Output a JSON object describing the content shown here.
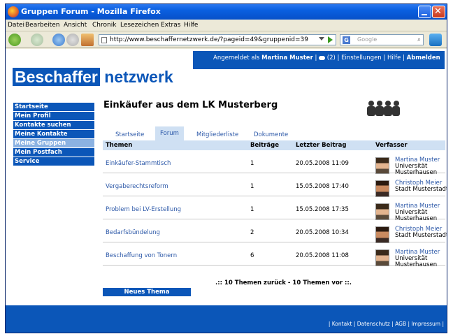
{
  "window": {
    "title": "Gruppen Forum - Mozilla Firefox"
  },
  "menu": [
    "Datei",
    "Bearbeiten",
    "Ansicht",
    "Chronik",
    "Lesezeichen",
    "Extras",
    "Hilfe"
  ],
  "toolbar": {
    "url": "http://www.beschaffernetzwerk.de/?pageid=49&gruppenid=39",
    "search_placeholder": "Google"
  },
  "userbar": {
    "prefix": "Angemeldet als",
    "user": "Martina Muster",
    "sep1": " | ",
    "messages": "(2)",
    "sep2": " | ",
    "settings": "Einstellungen",
    "sep3": " | ",
    "help": "Hilfe",
    "sep4": " | ",
    "logout": "Abmelden"
  },
  "logo": {
    "part1": "Beschaffer",
    "part2": " netzwerk"
  },
  "sidebar": {
    "items": [
      {
        "label": "Startseite"
      },
      {
        "label": "Mein Profil"
      },
      {
        "label": "Kontakte suchen"
      },
      {
        "label": "Meine Kontakte"
      },
      {
        "label": "Meine Gruppen",
        "active": true
      },
      {
        "label": "Mein Postfach"
      },
      {
        "label": "Service"
      }
    ]
  },
  "group": {
    "title": "Einkäufer aus dem LK Musterberg",
    "icon": "group-people-icon"
  },
  "tabs": [
    {
      "label": "Startseite"
    },
    {
      "label": "Forum",
      "active": true
    },
    {
      "label": "Mitgliederliste"
    },
    {
      "label": "Dokumente"
    }
  ],
  "table": {
    "headers": {
      "topics": "Themen",
      "posts": "Beiträge",
      "last_post": "Letzter Beitrag",
      "author": "Verfasser"
    },
    "rows": [
      {
        "topic": "Einkäufer-Stammtisch",
        "posts": "1",
        "date": "20.05.2008 11:09",
        "author": "Martina Muster",
        "org1": "Universität",
        "org2": "Musterhausen"
      },
      {
        "topic": "Vergaberechtsreform",
        "posts": "1",
        "date": "15.05.2008 17:40",
        "author": "Christoph Meier",
        "org1": "Stadt Musterstadt",
        "org2": ""
      },
      {
        "topic": "Problem bei LV-Erstellung",
        "posts": "1",
        "date": "15.05.2008 17:35",
        "author": "Martina Muster",
        "org1": "Universität",
        "org2": "Musterhausen"
      },
      {
        "topic": "Bedarfsbündelung",
        "posts": "2",
        "date": "20.05.2008 10:34",
        "author": "Christoph Meier",
        "org1": "Stadt Musterstadt",
        "org2": ""
      },
      {
        "topic": "Beschaffung von Tonern",
        "posts": "6",
        "date": "20.05.2008 11:08",
        "author": "Martina Muster",
        "org1": "Universität",
        "org2": "Musterhausen"
      }
    ]
  },
  "pager": ".:: 10 Themen zurück - 10 Themen vor ::.",
  "new_topic": "Neues Thema",
  "footer": "| Kontakt | Datenschutz | AGB | Impressum |"
}
